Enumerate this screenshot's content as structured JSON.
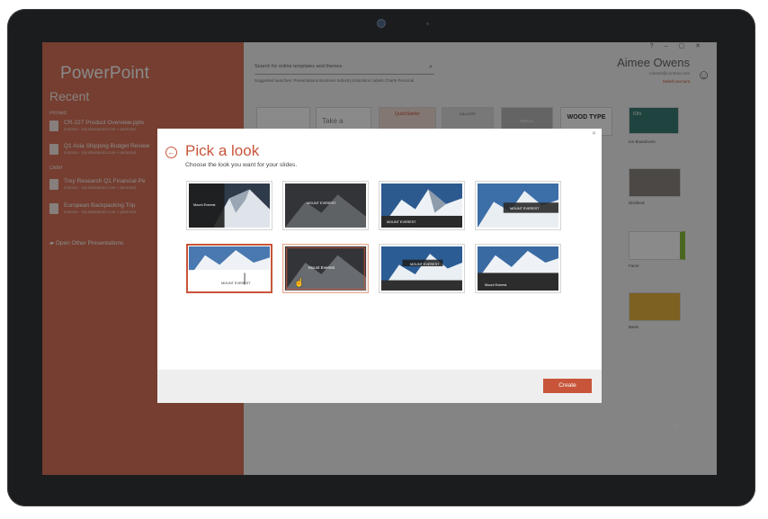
{
  "app": {
    "name": "PowerPoint",
    "recent_heading": "Recent"
  },
  "sidebar": {
    "pinned_label": "Pinned",
    "older_label": "Older",
    "files": [
      {
        "title": "CR-227 Product Overview.pptx",
        "path": "contoso - my.sharepoint.com » personal"
      },
      {
        "title": "Q1 Asia Shipping Budget Review",
        "path": "contoso - my.sharepoint.com » personal"
      },
      {
        "title": "Trey Research Q1 Financial Pe",
        "path": "contoso - my.sharepoint.com » personal"
      },
      {
        "title": "European Backpacking Trip",
        "path": "contoso - my.sharepoint.com » personal"
      }
    ],
    "open_other": "Open Other Presentations"
  },
  "search": {
    "placeholder": "Search for online templates and themes",
    "suggested": "Suggested searches:  Presentations  Business  Industry  Education  Labels  Charts  Personal"
  },
  "account": {
    "name": "Aimee Owens",
    "email": "Aimee0@contoso.com",
    "switch": "Switch account"
  },
  "gallery": {
    "items": [
      {
        "thumb": "Take a",
        "label": ""
      },
      {
        "thumb": "QuickStarter",
        "label": ""
      },
      {
        "thumb": "GALLERY",
        "label": ""
      },
      {
        "thumb": "PARCEL",
        "label": ""
      },
      {
        "thumb": "WOOD TYPE",
        "label": ""
      },
      {
        "thumb": "ION",
        "label": "Ion Boardroom"
      },
      {
        "thumb": "Dividend",
        "label": "Dividend"
      },
      {
        "thumb": "Facet",
        "label": "Facet"
      },
      {
        "thumb": "Basis",
        "label": "Basis"
      }
    ]
  },
  "dialog": {
    "title": "Pick a look",
    "subtitle": "Choose the look you want for your slides.",
    "create_label": "Create",
    "looks": [
      {
        "caption": "Mount Everest"
      },
      {
        "caption": "MOUNT EVEREST"
      },
      {
        "caption": "MOUNT EVEREST"
      },
      {
        "caption": "MOUNT EVEREST"
      },
      {
        "caption": "MOUNT EVEREST"
      },
      {
        "caption": "Mount Everest"
      },
      {
        "caption": "MOUNT EVEREST"
      },
      {
        "caption": "Mount Everest"
      }
    ]
  },
  "colors": {
    "accent": "#c8553a",
    "sidebar": "#d9745a"
  },
  "icons": {
    "back": "back-arrow-icon",
    "search": "search-icon",
    "avatar": "person-icon",
    "file": "pptx-file-icon",
    "folder": "folder-icon"
  }
}
